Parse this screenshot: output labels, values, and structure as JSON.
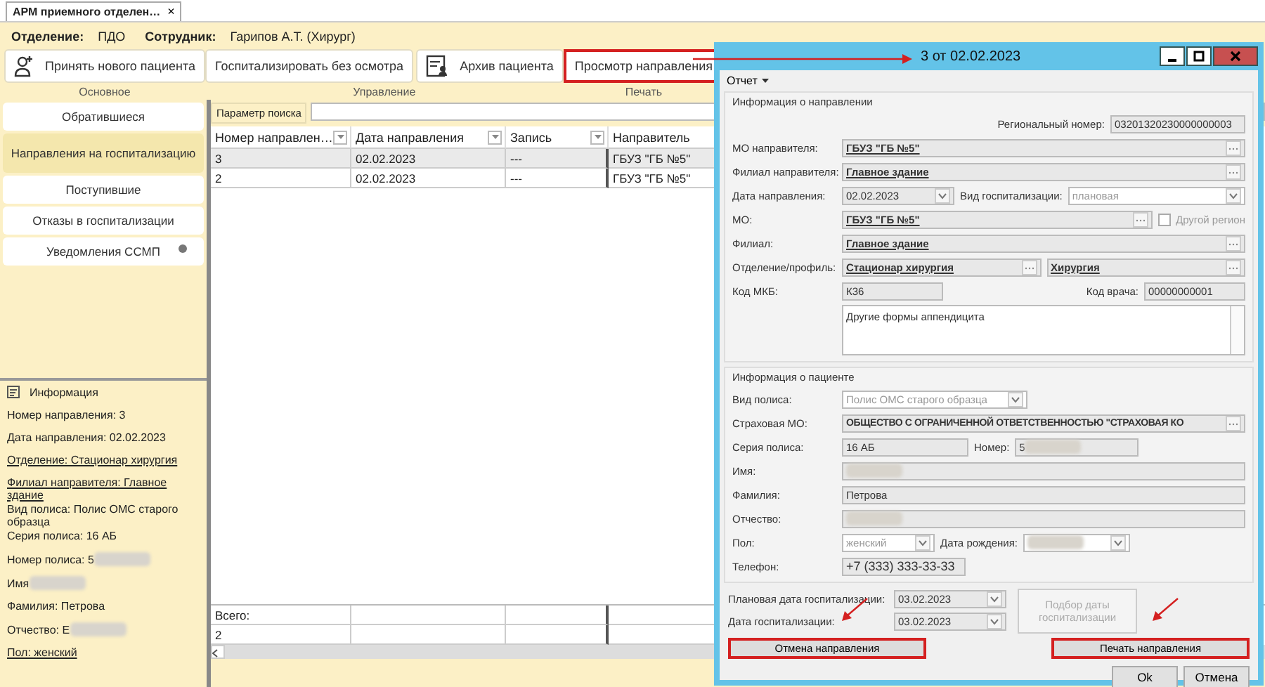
{
  "app_tab": {
    "title": "АРМ приемного отделен…",
    "close": "×"
  },
  "info_bar": [
    {
      "label": "Отделение:",
      "value": "ПДО"
    },
    {
      "label": "Сотрудник:",
      "value": "Гарипов А.Т. (Хирург)"
    }
  ],
  "ribbon": [
    {
      "label": "Основное",
      "buttons": [
        {
          "label": "Принять нового пациента",
          "kind": "add-patient",
          "highlighted": false
        }
      ]
    },
    {
      "label": "Управление",
      "buttons": [
        {
          "label": "Госпитализировать без осмотра",
          "kind": "text",
          "highlighted": false
        },
        {
          "label": "Архив пациента",
          "kind": "archive",
          "highlighted": false
        }
      ]
    },
    {
      "label": "Печать",
      "buttons": [
        {
          "label": "Просмотр направления",
          "kind": "text",
          "highlighted": true
        }
      ]
    }
  ],
  "sidebar": {
    "items": [
      {
        "label": "Обратившиеся",
        "selected": false,
        "indicator": false
      },
      {
        "label": "Направления на госпитализацию",
        "selected": true,
        "indicator": false
      },
      {
        "label": "Поступившие",
        "selected": false,
        "indicator": false
      },
      {
        "label": "Отказы в госпитализации",
        "selected": false,
        "indicator": false
      },
      {
        "label": "Уведомления ССМП",
        "selected": false,
        "indicator": true
      }
    ],
    "info": {
      "title": "Информация",
      "groups": [
        [
          {
            "text": "Номер направления: 3",
            "underlined": false,
            "redacted": false
          }
        ],
        [
          {
            "text": "Дата направления: 02.02.2023",
            "underlined": false,
            "redacted": false
          }
        ],
        [
          {
            "text": "Отделение: Стационар  хирургия",
            "underlined": true,
            "redacted": false
          }
        ],
        [
          {
            "text": "Филиал направителя: Главное здание",
            "underlined": true,
            "redacted": false
          },
          {
            "text": "Вид полиса: Полис ОМС старого образца",
            "underlined": false,
            "redacted": false
          },
          {
            "text": "Серия полиса: 16 АБ",
            "underlined": false,
            "redacted": false
          }
        ],
        [
          {
            "text": "Номер полиса: 5",
            "underlined": false,
            "redacted": true
          }
        ],
        [
          {
            "text": "Имя",
            "underlined": false,
            "redacted": true
          }
        ],
        [
          {
            "text": "Фамилия: Петрова",
            "underlined": false,
            "redacted": false
          }
        ],
        [
          {
            "text": "Отчество: Е",
            "underlined": false,
            "redacted": true
          }
        ],
        [
          {
            "text": "Пол: женский",
            "underlined": true,
            "redacted": false
          }
        ]
      ]
    }
  },
  "search": {
    "label": "Параметр поиска"
  },
  "table": {
    "columns": [
      {
        "title": "Номер  направлен…",
        "filter": true
      },
      {
        "title": "Дата направления",
        "filter": true
      },
      {
        "title": "Запись",
        "filter": true
      },
      {
        "title": "Направитель",
        "filter": false
      }
    ],
    "rows": [
      {
        "cells": [
          "3",
          "02.02.2023",
          "---",
          "ГБУЗ \"ГБ №5\""
        ],
        "selected": true
      },
      {
        "cells": [
          "2",
          "02.02.2023",
          "---",
          "ГБУЗ \"ГБ №5\""
        ],
        "selected": false
      }
    ],
    "footer": [
      "Всего:",
      "2"
    ]
  },
  "dialog": {
    "title": "3 от 02.02.2023",
    "menu": "Отчет",
    "sections": [
      {
        "title": "Информация о направлении",
        "rows": [
          {
            "kind": "right",
            "label": "Региональный номер:",
            "value": "03201320230000000003"
          },
          {
            "kind": "lookup",
            "label": "МО направителя:",
            "value": "ГБУЗ \"ГБ №5\""
          },
          {
            "kind": "lookup",
            "label": "Филиал направителя:",
            "value": "Главное здание"
          },
          {
            "kind": "date_combo",
            "label": "Дата направления:",
            "value": "02.02.2023",
            "label2": "Вид госпитализации:",
            "value2": "плановая",
            "disabled2": true
          },
          {
            "kind": "lookup_check",
            "label": "МО:",
            "value": "ГБУЗ \"ГБ №5\"",
            "check_label": "Другой регион",
            "checked": false
          },
          {
            "kind": "lookup",
            "label": "Филиал:",
            "value": "Главное здание"
          },
          {
            "kind": "lookup_pair",
            "label": "Отделение/профиль:",
            "value": "Стационар  хирургия",
            "value2": "Хирургия"
          },
          {
            "kind": "code_pair",
            "label": "Код МКБ:",
            "value": "К36",
            "label2": "Код врача:",
            "value2": "00000000001"
          },
          {
            "kind": "memo",
            "value": "Другие формы аппендицита"
          }
        ]
      },
      {
        "title": "Информация о пациенте",
        "rows": [
          {
            "kind": "combo",
            "label": "Вид полиса:",
            "value": "Полис ОМС старого образца",
            "disabled": true
          },
          {
            "kind": "lookup_plain",
            "label": "Страховая МО:",
            "value": "ОБЩЕСТВО С ОГРАНИЧЕННОЙ ОТВЕТСТВЕННОСТЬЮ \"СТРАХОВАЯ КО"
          },
          {
            "kind": "text_pair",
            "label": "Серия полиса:",
            "value": "16 АБ",
            "label2": "Номер:",
            "value2": "5",
            "redacted2": true
          },
          {
            "kind": "text",
            "label": "Имя:",
            "value": "",
            "redacted": true
          },
          {
            "kind": "text",
            "label": "Фамилия:",
            "value": "Петрова",
            "redacted": false
          },
          {
            "kind": "text",
            "label": "Отчество:",
            "value": "",
            "redacted": true
          },
          {
            "kind": "gender",
            "label": "Пол:",
            "value": "женский",
            "disabled": true,
            "label2": "Дата рождения:",
            "redacted2": true
          },
          {
            "kind": "short",
            "label": "Телефон:",
            "value": "+7 (333) 333-33-33"
          }
        ]
      }
    ],
    "schedule": [
      {
        "label": "Плановая дата госпитализации:",
        "value": "03.02.2023"
      },
      {
        "label": "Дата госпитализации:",
        "value": "03.02.2023"
      }
    ],
    "pick_button": {
      "label": "Подбор даты госпитализации",
      "disabled": true
    },
    "actions": [
      {
        "label": "Отмена направления",
        "highlighted": true
      },
      {
        "label": "Печать направления",
        "highlighted": true
      }
    ],
    "buttons": [
      "Ok",
      "Отмена"
    ]
  }
}
